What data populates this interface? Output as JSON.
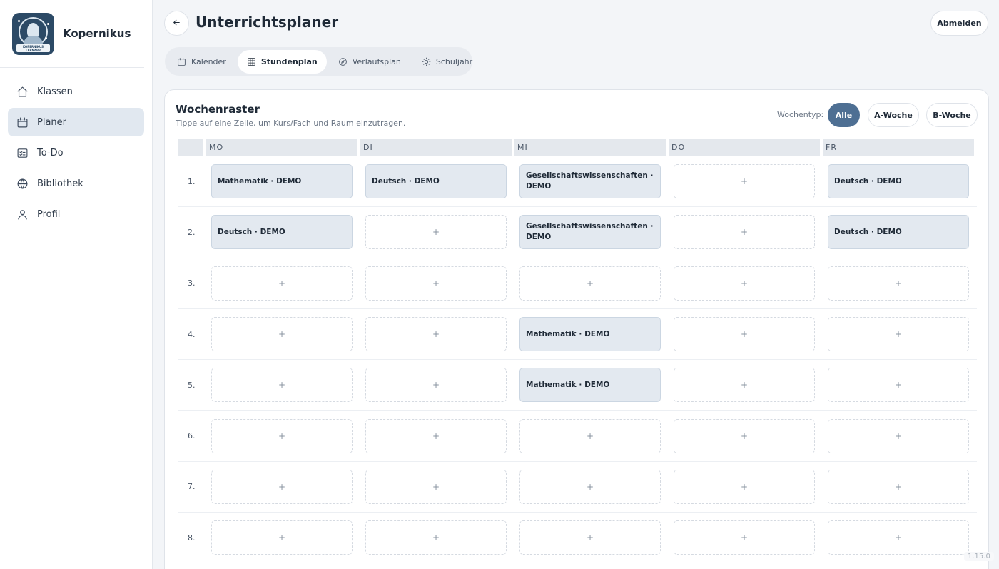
{
  "brand": {
    "name": "Kopernikus",
    "logo_text": "KOPERNIKUS LERNAPP"
  },
  "sidebar": {
    "items": [
      {
        "label": "Klassen",
        "icon": "home-icon",
        "active": false
      },
      {
        "label": "Planer",
        "icon": "calendar-icon",
        "active": true
      },
      {
        "label": "To-Do",
        "icon": "checklist-icon",
        "active": false
      },
      {
        "label": "Bibliothek",
        "icon": "globe-icon",
        "active": false
      },
      {
        "label": "Profil",
        "icon": "user-icon",
        "active": false
      }
    ]
  },
  "header": {
    "title": "Unterrichtsplaner",
    "logout_label": "Abmelden"
  },
  "tabs": [
    {
      "label": "Kalender",
      "icon": "calendar-icon",
      "active": false
    },
    {
      "label": "Stundenplan",
      "icon": "grid-icon",
      "active": true
    },
    {
      "label": "Verlaufsplan",
      "icon": "compass-icon",
      "active": false
    },
    {
      "label": "Schuljahr",
      "icon": "sun-icon",
      "active": false
    }
  ],
  "card": {
    "title": "Wochenraster",
    "subtitle": "Tippe auf eine Zelle, um Kurs/Fach und Raum einzutragen.",
    "week_type_label": "Wochentyp:",
    "week_types": [
      {
        "label": "Alle",
        "active": true
      },
      {
        "label": "A-Woche",
        "active": false
      },
      {
        "label": "B-Woche",
        "active": false
      }
    ]
  },
  "timetable": {
    "days": [
      "MO",
      "DI",
      "MI",
      "DO",
      "FR"
    ],
    "empty_symbol": "+",
    "rows": [
      {
        "label": "1.",
        "cells": [
          "Mathematik · DEMO",
          "Deutsch · DEMO",
          "Gesellschaftswissenschaften · DEMO",
          "",
          "Deutsch · DEMO"
        ]
      },
      {
        "label": "2.",
        "cells": [
          "Deutsch · DEMO",
          "",
          "Gesellschaftswissenschaften · DEMO",
          "",
          "Deutsch · DEMO"
        ]
      },
      {
        "label": "3.",
        "cells": [
          "",
          "",
          "",
          "",
          ""
        ]
      },
      {
        "label": "4.",
        "cells": [
          "",
          "",
          "Mathematik · DEMO",
          "",
          ""
        ]
      },
      {
        "label": "5.",
        "cells": [
          "",
          "",
          "Mathematik · DEMO",
          "",
          ""
        ]
      },
      {
        "label": "6.",
        "cells": [
          "",
          "",
          "",
          "",
          ""
        ]
      },
      {
        "label": "7.",
        "cells": [
          "",
          "",
          "",
          "",
          ""
        ]
      },
      {
        "label": "8.",
        "cells": [
          "",
          "",
          "",
          "",
          ""
        ]
      }
    ]
  },
  "version": "1.15.0",
  "colors": {
    "accent": "#4e6f93",
    "filled_cell": "#e3e9f0",
    "logo_bg": "#2c4a66"
  }
}
